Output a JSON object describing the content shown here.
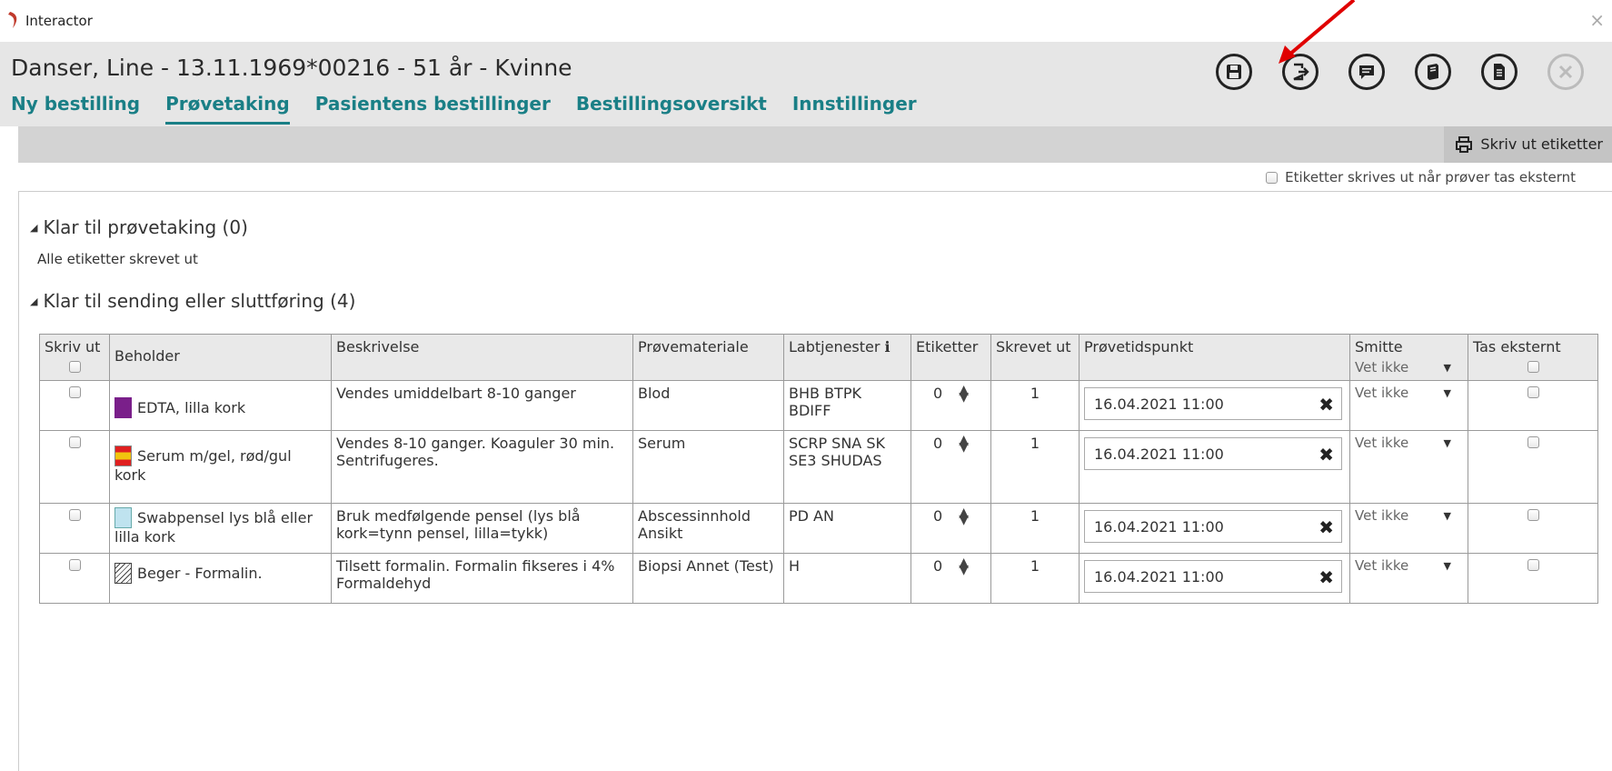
{
  "window": {
    "title": "Interactor",
    "close_glyph": "×"
  },
  "patient": {
    "header": "Danser, Line - 13.11.1969*00216 - 51 år - Kvinne"
  },
  "tabs": [
    {
      "label": "Ny bestilling",
      "active": false
    },
    {
      "label": "Prøvetaking",
      "active": true
    },
    {
      "label": "Pasientens bestillinger",
      "active": false
    },
    {
      "label": "Bestillingsoversikt",
      "active": false
    },
    {
      "label": "Innstillinger",
      "active": false
    }
  ],
  "toolbar_icons": [
    "save-icon",
    "exit-icon",
    "comment-icon",
    "book-icon",
    "document-icon",
    "close-icon"
  ],
  "toolbar": {
    "print_label": "Skriv ut etiketter",
    "external_option": "Etiketter skrives ut når prøver tas eksternt"
  },
  "sections": {
    "ready_sampling": {
      "title": "Klar til prøvetaking (0)",
      "note": "Alle etiketter skrevet ut"
    },
    "ready_sending": {
      "title": "Klar til sending eller sluttføring (4)"
    }
  },
  "table": {
    "headers": {
      "print": "Skriv ut",
      "container": "Beholder",
      "description": "Beskrivelse",
      "material": "Prøvemateriale",
      "labservices": "Labtjenester",
      "info_glyph": "ℹ",
      "labels": "Etiketter",
      "printed": "Skrevet ut",
      "sampletime": "Prøvetidspunkt",
      "infection": "Smitte",
      "infection_value": "Vet ikke",
      "external": "Tas eksternt"
    },
    "rows": [
      {
        "container": "EDTA, lilla kork",
        "swatch": "purple",
        "description": "Vendes umiddelbart 8-10 ganger",
        "material": "Blod",
        "labservices": "BHB  BTPK BDIFF",
        "labels": "0",
        "printed": "1",
        "sampletime": "16.04.2021 11:00",
        "infection": "Vet ikke"
      },
      {
        "container": "Serum m/gel, rød/gul kork",
        "swatch": "red-yellow",
        "description": "Vendes 8-10 ganger. Koaguler 30 min. Sentrifugeres.",
        "material": "Serum",
        "labservices": "SCRP  SNA SK  SE3 SHUDAS",
        "labels": "0",
        "printed": "1",
        "sampletime": "16.04.2021 11:00",
        "infection": "Vet ikke"
      },
      {
        "container": "Swabpensel lys blå eller lilla kork",
        "swatch": "light-blue",
        "description": "Bruk medfølgende pensel (lys blå kork=tynn pensel, lilla=tykk)",
        "material": "Abscessinnhold Ansikt",
        "labservices": "PD  AN",
        "labels": "0",
        "printed": "1",
        "sampletime": "16.04.2021 11:00",
        "infection": "Vet ikke"
      },
      {
        "container": "Beger - Formalin.",
        "swatch": "hatched",
        "description": "Tilsett formalin. Formalin fikseres i 4% Formaldehyd",
        "material": "Biopsi Annet (Test)",
        "labservices": "H",
        "labels": "0",
        "printed": "1",
        "sampletime": "16.04.2021 11:00",
        "infection": "Vet ikke"
      }
    ]
  },
  "colors": {
    "accent": "#1a7f86",
    "header_bg": "#e6e6e6",
    "annotation_arrow": "#e00000"
  }
}
